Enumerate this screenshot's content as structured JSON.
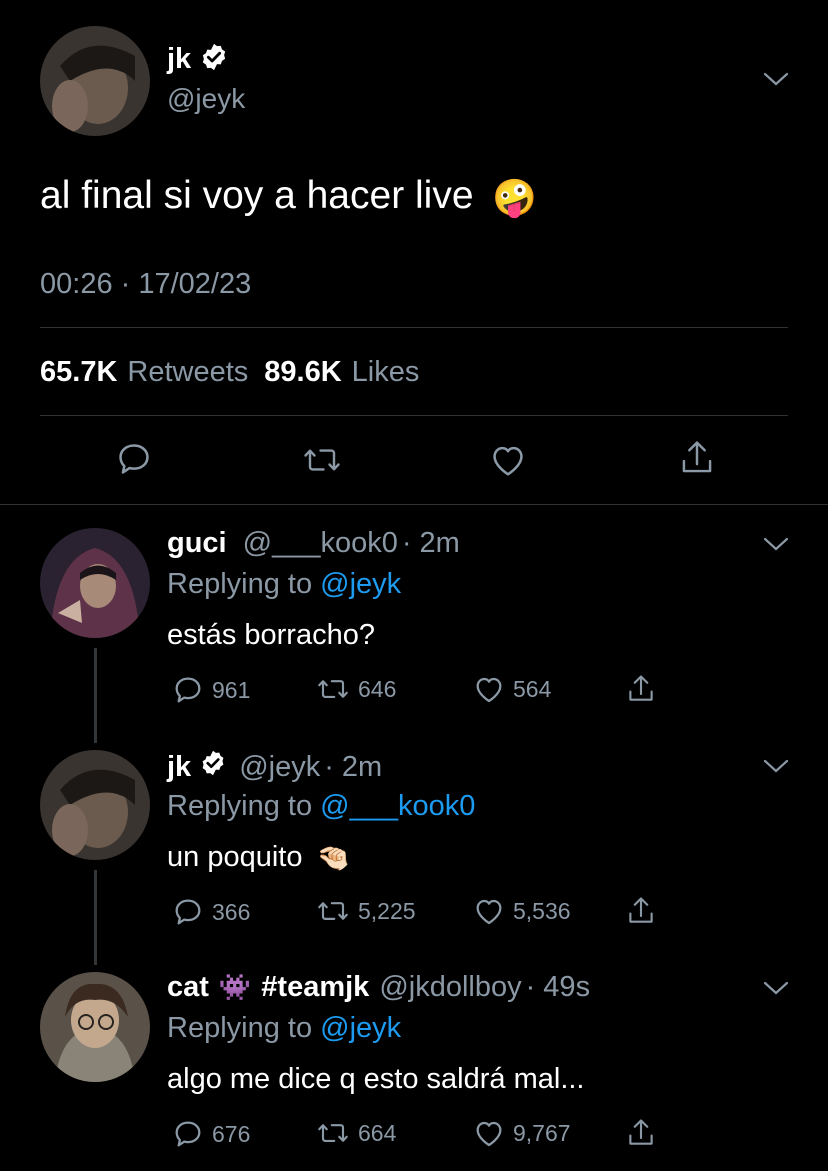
{
  "main_tweet": {
    "display_name": "jk",
    "handle": "@jeyk",
    "text": "al final si voy a hacer live",
    "emoji": "🤪",
    "timestamp": "00:26 · 17/02/23",
    "retweets_count": "65.7K",
    "retweets_label": "Retweets",
    "likes_count": "89.6K",
    "likes_label": "Likes"
  },
  "replies": [
    {
      "display_name": "guci",
      "handle": "@___kook0",
      "time": "· 2m",
      "replying_label": "Replying to",
      "replying_to": "@jeyk",
      "text": "estás borracho?",
      "reply_count": "961",
      "retweet_count": "646",
      "like_count": "564"
    },
    {
      "display_name": "jk",
      "handle": "@jeyk",
      "time": "· 2m",
      "replying_label": "Replying to",
      "replying_to": "@___kook0",
      "text": "un poquito",
      "emoji": "🤏🏻",
      "reply_count": "366",
      "retweet_count": "5,225",
      "like_count": "5,536"
    },
    {
      "display_name": "cat",
      "name_emoji": "👾",
      "name_suffix": "#teamjk",
      "handle": "@jkdollboy",
      "time": "· 49s",
      "replying_label": "Replying to",
      "replying_to": "@jeyk",
      "text": "algo me dice q esto saldrá mal...",
      "reply_count": "676",
      "retweet_count": "664",
      "like_count": "9,767"
    }
  ],
  "colors": {
    "background": "#000000",
    "secondary_text": "#8b98a5",
    "link": "#1d9bf0",
    "divider": "#2f3336"
  }
}
